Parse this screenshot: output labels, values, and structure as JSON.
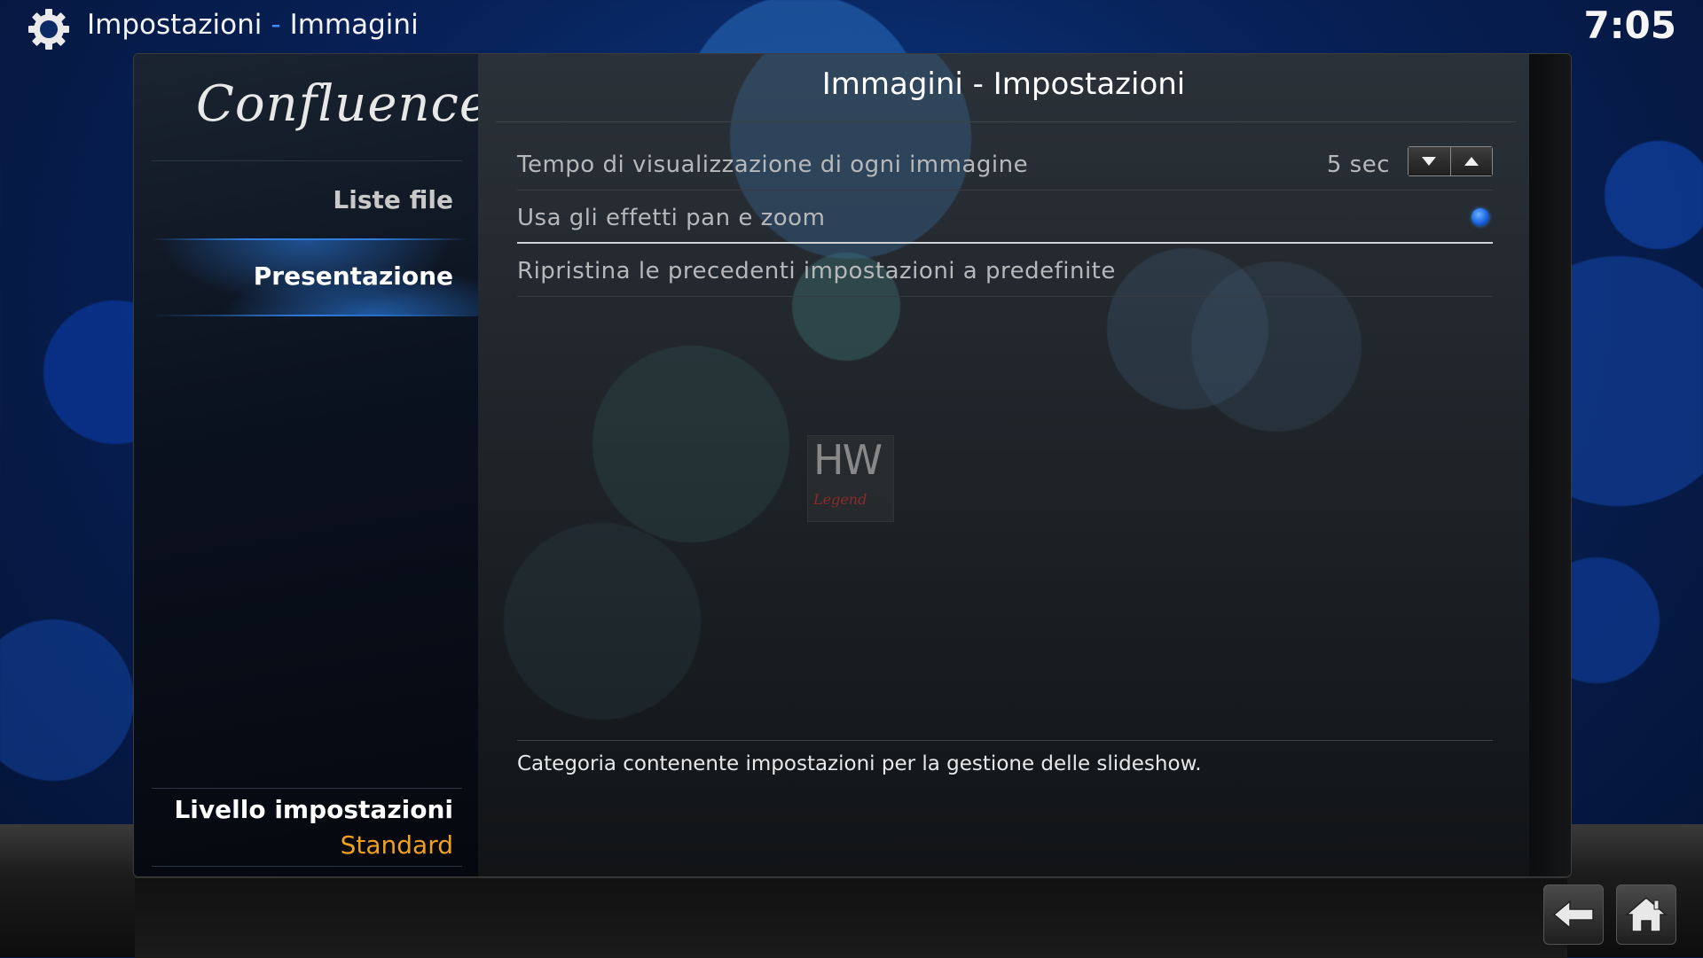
{
  "header": {
    "section": "Impostazioni",
    "separator": "-",
    "subsection": "Immagini",
    "clock": "7:05"
  },
  "sidebar": {
    "logo": "Confluence",
    "items": [
      {
        "label": "Liste file"
      },
      {
        "label": "Presentazione"
      }
    ],
    "level_label": "Livello impostazioni",
    "level_value": "Standard"
  },
  "dialog": {
    "title": "Immagini - Impostazioni",
    "close_symbol": "✕",
    "settings": [
      {
        "label": "Tempo di visualizzazione di ogni immagine",
        "value": "5 sec",
        "control": "spinner"
      },
      {
        "label": "Usa gli effetti pan e zoom",
        "value": "on",
        "control": "radio"
      },
      {
        "label": "Ripristina le precedenti impostazioni a predefinite",
        "control": "action"
      }
    ],
    "description": "Categoria contenente impostazioni per la gestione delle slideshow."
  },
  "watermark": {
    "line1": "HW",
    "line2": "Legend"
  },
  "colors": {
    "accent": "#2f7de0",
    "level_value": "#f0a021"
  },
  "icons": [
    "gear-icon",
    "close-icon",
    "arrow-down-icon",
    "arrow-up-icon",
    "back-icon",
    "home-icon"
  ]
}
